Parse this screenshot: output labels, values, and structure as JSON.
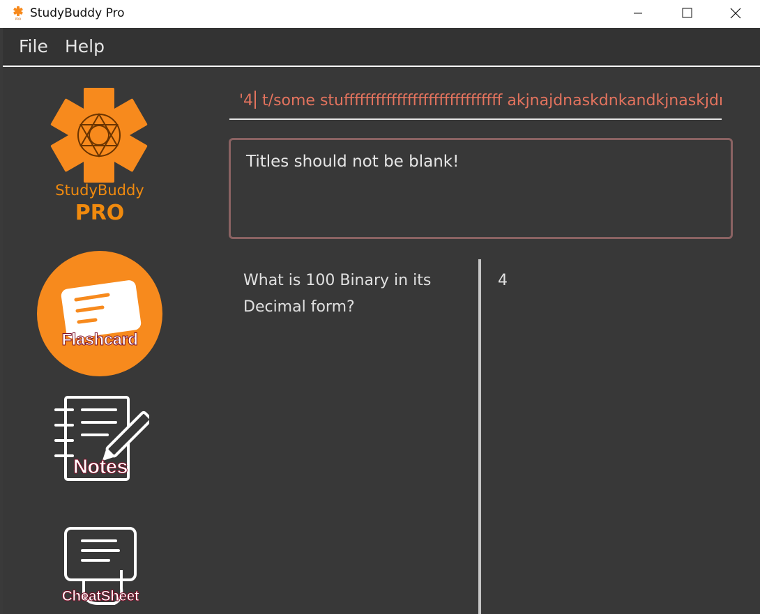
{
  "window": {
    "title": "StudyBuddy Pro"
  },
  "menubar": {
    "items": [
      {
        "label": "File"
      },
      {
        "label": "Help"
      }
    ]
  },
  "logo": {
    "title": "StudyBuddy",
    "subtitle": "PRO"
  },
  "sidebar": {
    "items": [
      {
        "label": "Flashcard",
        "icon": "flashcard-icon"
      },
      {
        "label": "Notes",
        "icon": "notes-icon"
      },
      {
        "label": "CheatSheet",
        "icon": "cheatsheet-icon"
      }
    ]
  },
  "command": {
    "value_before_caret": "'4",
    "value_after_caret": " t/some stuffffffffffffffffffffffffffffff akjnajdnaskdnkandkjnaskjdr"
  },
  "result": {
    "message": "Titles should not be blank!"
  },
  "flashcard": {
    "question": "What is 100 Binary in its Decimal form?",
    "answer": "4"
  },
  "colors": {
    "accent": "#f78a1d",
    "error_text": "#e3735e",
    "background": "#383838",
    "menubar": "#333333",
    "label_outline": "#7d0f28"
  }
}
